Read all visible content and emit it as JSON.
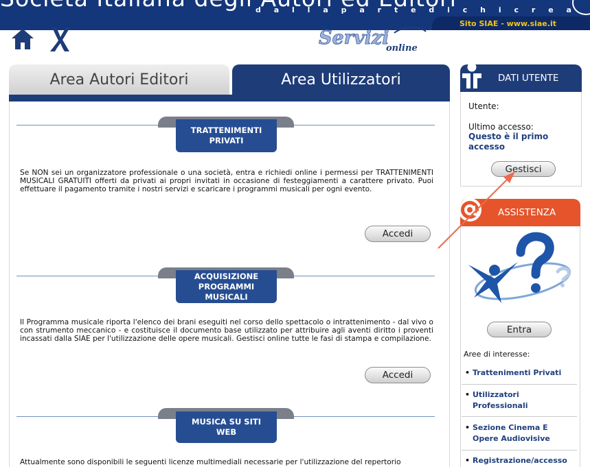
{
  "banner": {
    "title": "Società Italiana degli Autori ed Editori",
    "motto_letters": [
      "d",
      "a",
      "l",
      "l",
      "a",
      "p",
      "a",
      "r",
      "t",
      "e",
      "d",
      "i",
      "c",
      "h",
      "i",
      "c",
      "r",
      "e",
      "a"
    ],
    "site": "Sito SIAE - www.siae.it"
  },
  "logo": {
    "name": "Servizi online"
  },
  "tabs": [
    {
      "label": "Area Autori Editori"
    },
    {
      "label": "Area Utilizzatori"
    }
  ],
  "sections": [
    {
      "title": "TRATTENIMENTI PRIVATI",
      "text": "Se NON sei un organizzatore professionale o una società, entra e richiedi online i permessi per TRATTENIMENTI MUSICALI GRATUITI offerti da privati ai propri invitati in occasione di festeggiamenti a carattere privato. Puoi effettuare il pagamento tramite i nostri servizi e scaricare i programmi musicali per ogni evento.",
      "button": "Accedi"
    },
    {
      "title": "ACQUISIZIONE PROGRAMMI MUSICALI",
      "text": "Il Programma musicale riporta l'elenco dei brani eseguiti nel corso dello spettacolo o intrattenimento - dal vivo o con strumento meccanico - e costituisce il documento base utilizzato per attribuire agli aventi diritto i proventi incassati dalla SIAE per l'utilizzazione delle opere musicali. Gestisci online tutte le fasi di stampa e compilazione.",
      "button": "Accedi"
    },
    {
      "title": "MUSICA SU SITI WEB",
      "text": "Attualmente sono disponibili le seguenti licenze multimediali necessarie per l'utilizzazione del repertorio"
    }
  ],
  "dati_utente": {
    "title": "DATI UTENTE",
    "user_label": "Utente:",
    "last_access_label": "Ultimo accesso:",
    "last_access_value": "Questo è il primo accesso",
    "button": "Gestisci"
  },
  "assistenza": {
    "title": "ASSISTENZA",
    "button": "Entra",
    "aree_label": "Aree di interesse:",
    "links": [
      "Trattenimenti Privati",
      "Utilizzatori Professionali",
      "Sezione Cinema E Opere Audiovisive",
      "Registrazione/accesso"
    ]
  },
  "colors": {
    "navy": "#1e3c78",
    "badge": "#264d92",
    "assistenza": "#e5542a",
    "link": "#1f3f7e",
    "arrow": "#ef6a4c"
  }
}
